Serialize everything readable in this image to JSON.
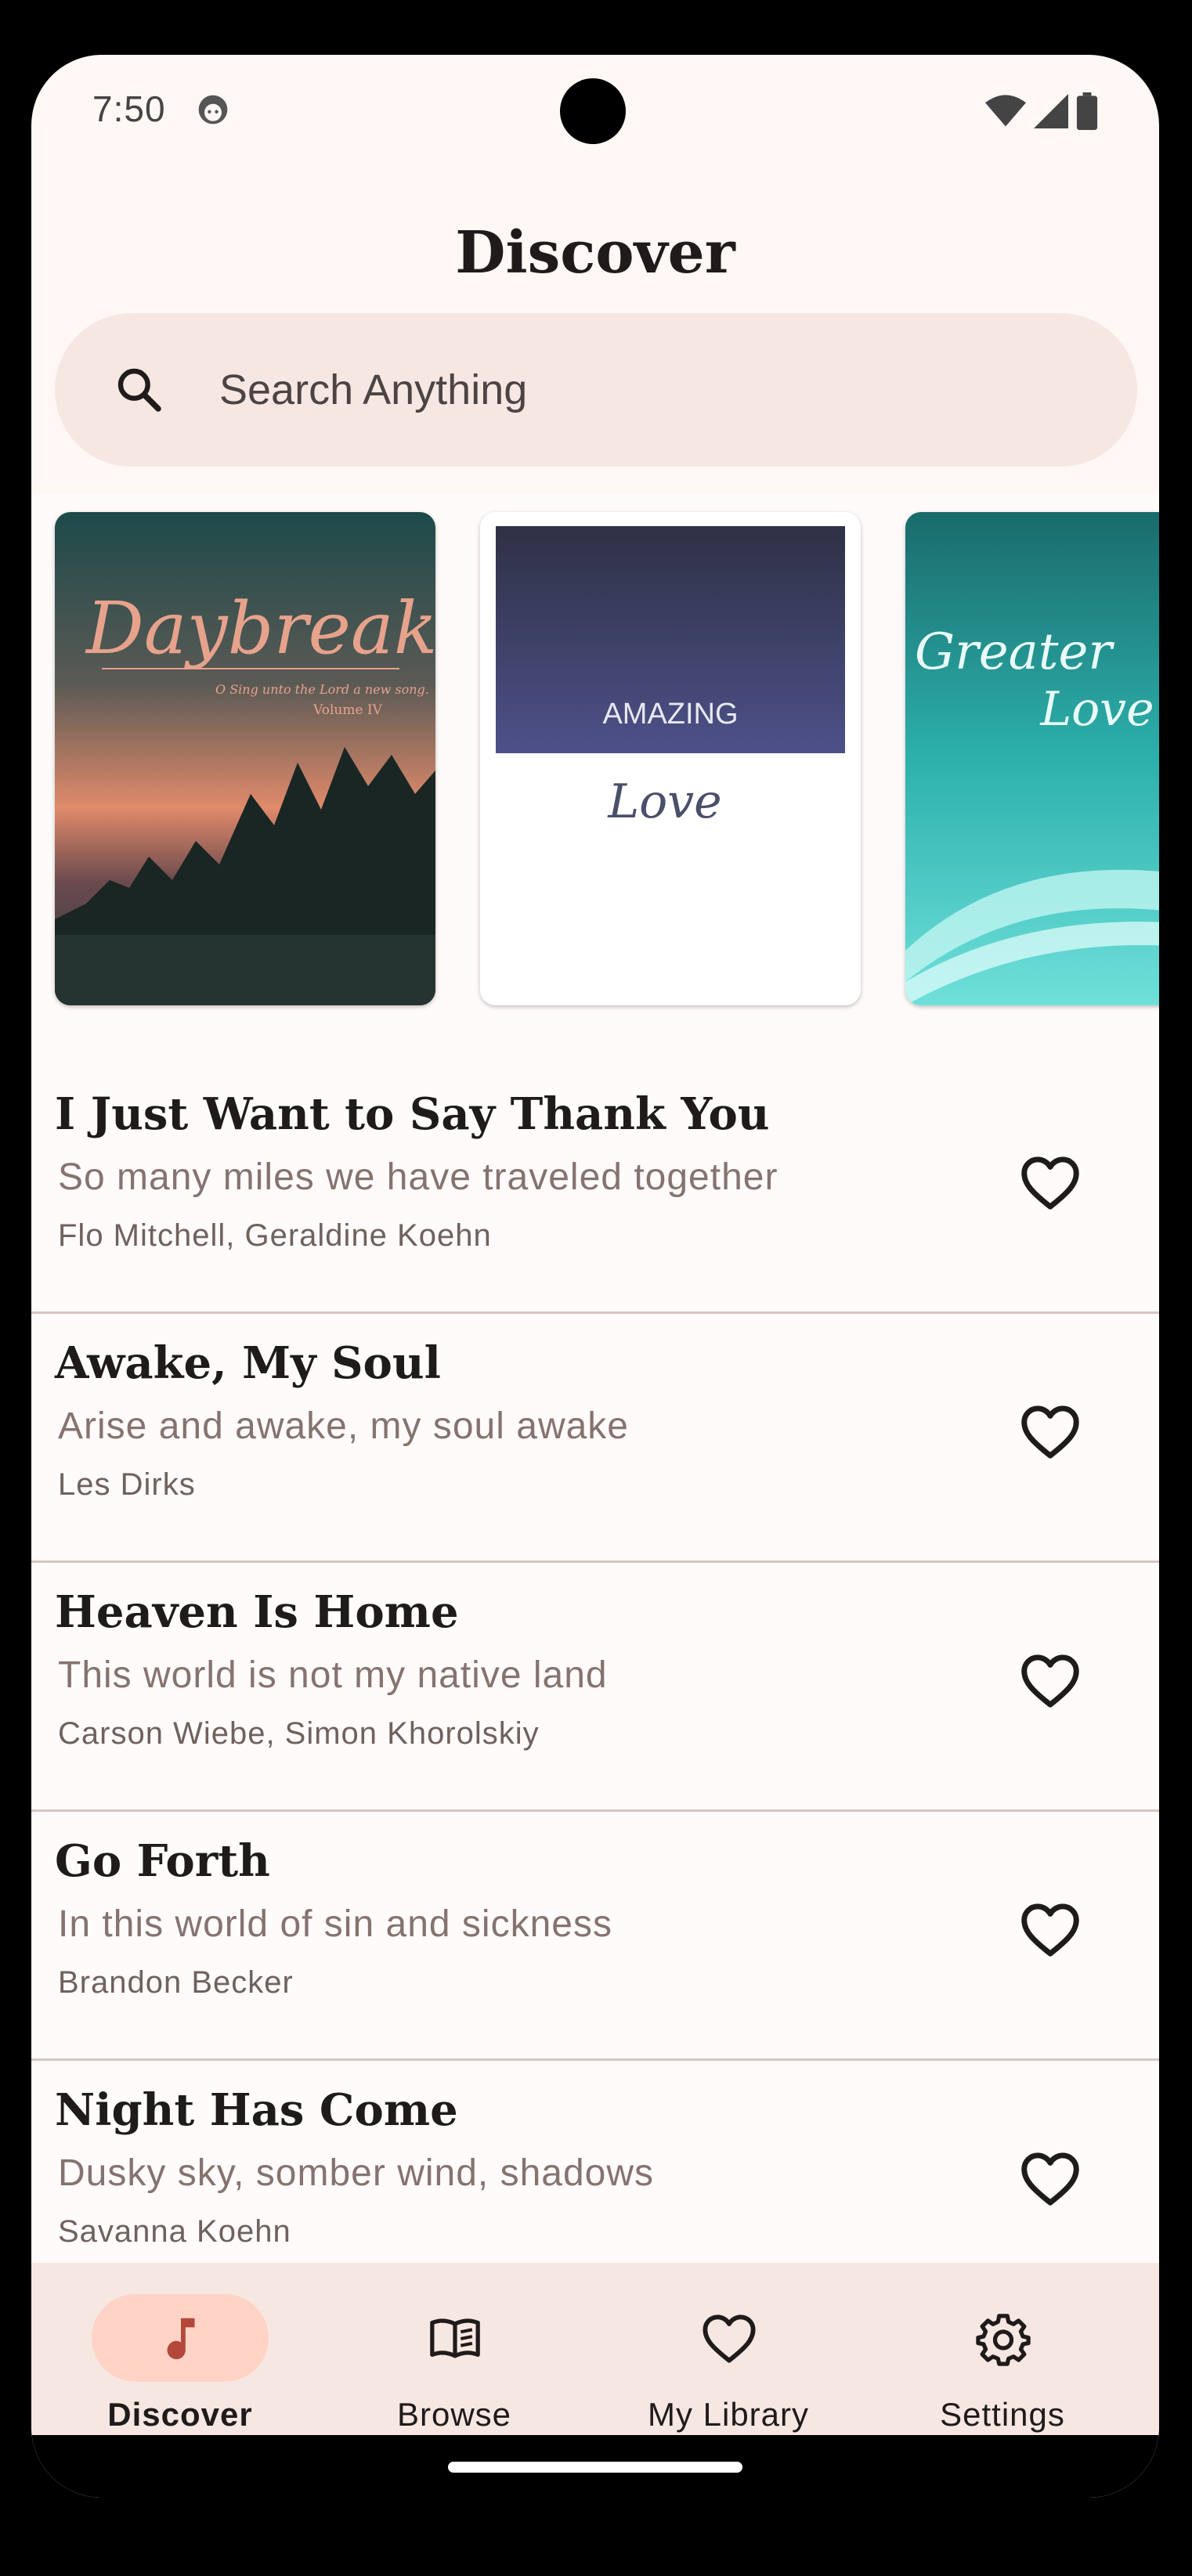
{
  "status_bar": {
    "time": "7:50",
    "icons": [
      "notification-face-icon",
      "wifi-icon",
      "cellular-signal-icon",
      "battery-icon"
    ]
  },
  "header": {
    "title": "Discover"
  },
  "search": {
    "placeholder": "Search Anything",
    "value": ""
  },
  "featured_books": [
    {
      "title": "Daybreak",
      "subtitle": "O Sing unto the Lord a new song.",
      "volume": "Volume IV"
    },
    {
      "title": "AMAZING",
      "subtitle": "Love"
    },
    {
      "title": "Greater",
      "subtitle": "Love"
    }
  ],
  "songs": [
    {
      "title": "I Just Want to Say Thank You",
      "first_line": "So many miles we have traveled together",
      "authors": "Flo Mitchell, Geraldine Koehn"
    },
    {
      "title": "Awake, My Soul",
      "first_line": "Arise and awake, my soul awake",
      "authors": "Les Dirks"
    },
    {
      "title": "Heaven Is Home",
      "first_line": "This world is not my native land",
      "authors": "Carson Wiebe, Simon Khorolskiy"
    },
    {
      "title": "Go Forth",
      "first_line": "In this world of sin and sickness",
      "authors": "Brandon Becker"
    },
    {
      "title": "Night Has Come",
      "first_line": "Dusky sky, somber wind, shadows",
      "authors": "Savanna Koehn"
    }
  ],
  "bottom_nav": [
    {
      "label": "Discover",
      "icon": "music-note-icon",
      "active": true
    },
    {
      "label": "Browse",
      "icon": "open-book-icon",
      "active": false
    },
    {
      "label": "My Library",
      "icon": "heart-icon",
      "active": false
    },
    {
      "label": "Settings",
      "icon": "gear-icon",
      "active": false
    }
  ],
  "colors": {
    "background": "#fff7f4",
    "search_bg": "#f7e7e2",
    "active_pill": "#ffd3c6",
    "accent": "#b3473a",
    "divider": "#d8c5c0"
  }
}
